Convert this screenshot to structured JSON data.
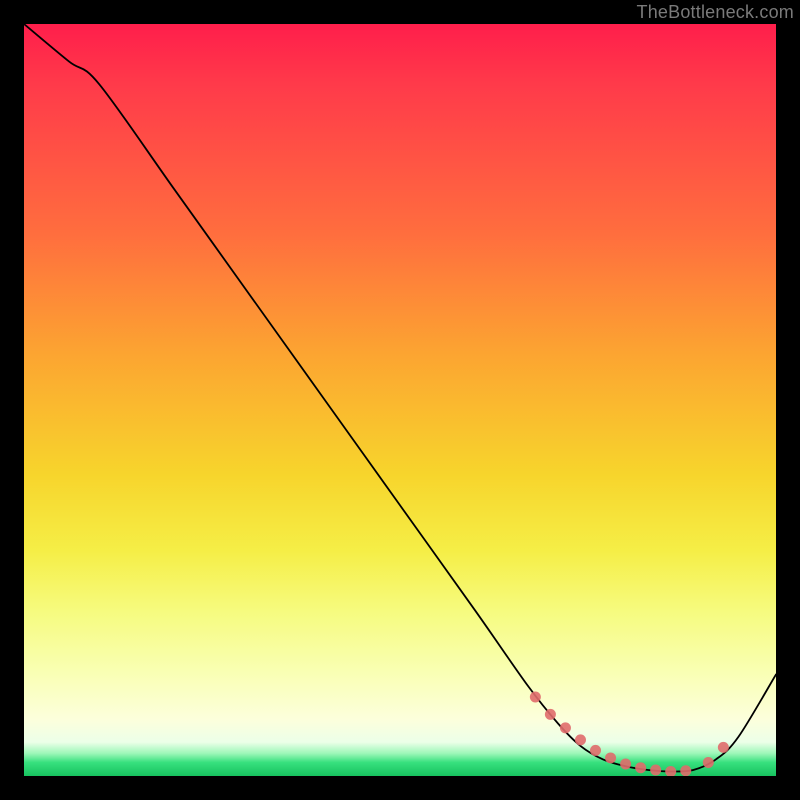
{
  "watermark": "TheBottleneck.com",
  "chart_data": {
    "type": "line",
    "title": "",
    "xlabel": "",
    "ylabel": "",
    "xlim": [
      0,
      100
    ],
    "ylim": [
      0,
      100
    ],
    "grid": false,
    "legend": false,
    "series": [
      {
        "name": "bottleneck-curve",
        "x": [
          0,
          6,
          10,
          20,
          30,
          40,
          50,
          60,
          67,
          71,
          74,
          77,
          80,
          83,
          86,
          89,
          92,
          95,
          100
        ],
        "values": [
          100,
          95,
          92,
          78,
          64,
          50,
          36,
          22,
          12,
          7,
          4,
          2.2,
          1.3,
          0.8,
          0.6,
          0.8,
          2.2,
          5.2,
          13.5
        ]
      }
    ],
    "markers": {
      "name": "highlight-dots",
      "x": [
        68,
        70,
        72,
        74,
        76,
        78,
        80,
        82,
        84,
        86,
        88,
        91,
        93
      ],
      "values": [
        10.5,
        8.2,
        6.4,
        4.8,
        3.4,
        2.4,
        1.6,
        1.1,
        0.8,
        0.6,
        0.7,
        1.8,
        3.8
      ]
    },
    "background_gradient": {
      "orientation": "vertical",
      "stops": [
        {
          "pos": 0.0,
          "color": "#ff1e4b"
        },
        {
          "pos": 0.28,
          "color": "#ff6e3e"
        },
        {
          "pos": 0.6,
          "color": "#f7d52c"
        },
        {
          "pos": 0.86,
          "color": "#f9ffb2"
        },
        {
          "pos": 0.97,
          "color": "#9cf7b8"
        },
        {
          "pos": 1.0,
          "color": "#17c25f"
        }
      ]
    }
  }
}
